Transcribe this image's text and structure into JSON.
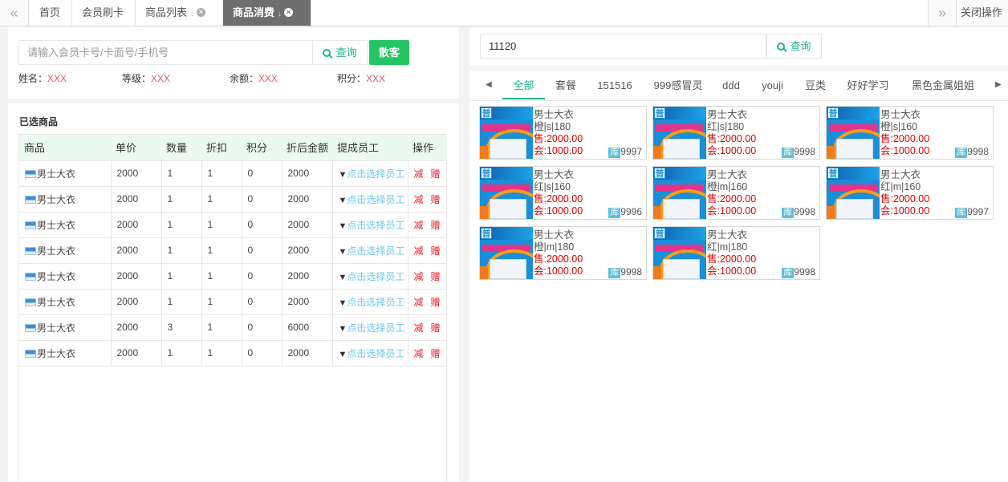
{
  "tabs": {
    "prev_icon": "«",
    "next_icon": "»",
    "items": [
      {
        "label": "首页"
      },
      {
        "label": "会员刷卡"
      },
      {
        "label": "商品列表"
      },
      {
        "label": "商品消费"
      }
    ],
    "close_ops_label": "关闭操作"
  },
  "member": {
    "placeholder": "请输入会员卡号/卡面号/手机号",
    "search_label": "查询",
    "walkin_label": "散客",
    "info": [
      {
        "label": "姓名：",
        "value": "XXX"
      },
      {
        "label": "等级：",
        "value": "XXX"
      },
      {
        "label": "余额：",
        "value": "XXX"
      },
      {
        "label": "积分：",
        "value": "XXX"
      }
    ]
  },
  "selected": {
    "title": "已选商品",
    "headers": [
      "商品",
      "单价",
      "数量",
      "折扣",
      "积分",
      "折后金额",
      "提成员工",
      "操作"
    ],
    "employee_label": "点击选择员工",
    "reduce_label": "减",
    "gift_label": "赠",
    "rows": [
      {
        "name": "男士大衣",
        "price": "2000",
        "qty": "1",
        "discount": "1",
        "points": "0",
        "amount": "2000"
      },
      {
        "name": "男士大衣",
        "price": "2000",
        "qty": "1",
        "discount": "1",
        "points": "0",
        "amount": "2000"
      },
      {
        "name": "男士大衣",
        "price": "2000",
        "qty": "1",
        "discount": "1",
        "points": "0",
        "amount": "2000"
      },
      {
        "name": "男士大衣",
        "price": "2000",
        "qty": "1",
        "discount": "1",
        "points": "0",
        "amount": "2000"
      },
      {
        "name": "男士大衣",
        "price": "2000",
        "qty": "1",
        "discount": "1",
        "points": "0",
        "amount": "2000"
      },
      {
        "name": "男士大衣",
        "price": "2000",
        "qty": "1",
        "discount": "1",
        "points": "0",
        "amount": "2000"
      },
      {
        "name": "男士大衣",
        "price": "2000",
        "qty": "3",
        "discount": "1",
        "points": "0",
        "amount": "6000"
      },
      {
        "name": "男士大衣",
        "price": "2000",
        "qty": "1",
        "discount": "1",
        "points": "0",
        "amount": "2000"
      }
    ]
  },
  "product_search": {
    "value": "11120",
    "search_label": "查询"
  },
  "categories": [
    "全部",
    "套餐",
    "151516",
    "999感冒灵",
    "ddd",
    "youji",
    "豆类",
    "好好学习",
    "黑色金属姐姐"
  ],
  "products": [
    {
      "tag": "普",
      "name": "男士大衣",
      "spec": "橙|s|180",
      "sale": "售:2000.00",
      "member": "会:1000.00",
      "stock_label": "库",
      "stock": "9997"
    },
    {
      "tag": "普",
      "name": "男士大衣",
      "spec": "红|s|180",
      "sale": "售:2000.00",
      "member": "会:1000.00",
      "stock_label": "库",
      "stock": "9998"
    },
    {
      "tag": "普",
      "name": "男士大衣",
      "spec": "橙|s|160",
      "sale": "售:2000.00",
      "member": "会:1000.00",
      "stock_label": "库",
      "stock": "9998"
    },
    {
      "tag": "普",
      "name": "男士大衣",
      "spec": "红|s|160",
      "sale": "售:2000.00",
      "member": "会:1000.00",
      "stock_label": "库",
      "stock": "9996"
    },
    {
      "tag": "普",
      "name": "男士大衣",
      "spec": "橙|m|160",
      "sale": "售:2000.00",
      "member": "会:1000.00",
      "stock_label": "库",
      "stock": "9998"
    },
    {
      "tag": "普",
      "name": "男士大衣",
      "spec": "红|m|160",
      "sale": "售:2000.00",
      "member": "会:1000.00",
      "stock_label": "库",
      "stock": "9997"
    },
    {
      "tag": "普",
      "name": "男士大衣",
      "spec": "橙|m|180",
      "sale": "售:2000.00",
      "member": "会:1000.00",
      "stock_label": "库",
      "stock": "9998"
    },
    {
      "tag": "普",
      "name": "男士大衣",
      "spec": "红|m|180",
      "sale": "售:2000.00",
      "member": "会:1000.00",
      "stock_label": "库",
      "stock": "9998"
    }
  ],
  "colors": {
    "accent": "#1ab394",
    "walkin": "#23c564",
    "price": "#dd0000",
    "info_value": "#ed5565"
  }
}
